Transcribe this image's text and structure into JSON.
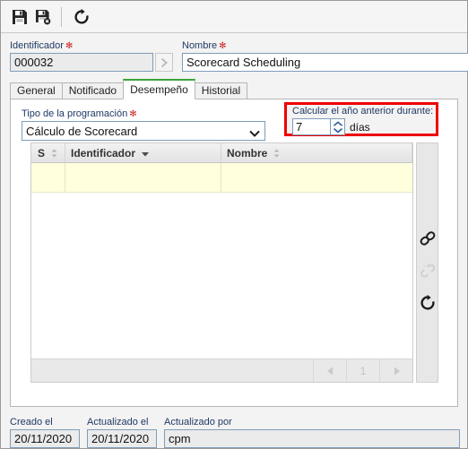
{
  "window": {
    "title": "Scorecard Scheduling"
  },
  "toolbar": {
    "save": {
      "name": "save-icon",
      "title": "Guardar"
    },
    "save_close": {
      "name": "save-and-close-icon",
      "title": "Guardar y cerrar"
    },
    "refresh": {
      "name": "refresh-icon",
      "title": "Actualizar"
    }
  },
  "header": {
    "identifier": {
      "label": "Identificador",
      "required_marker": "✻",
      "value": "000032",
      "nav_button": "›"
    },
    "name": {
      "label": "Nombre",
      "required_marker": "✻",
      "value": "Scorecard Scheduling"
    }
  },
  "tabs": [
    {
      "label": "General",
      "active": false
    },
    {
      "label": "Notificado",
      "active": false
    },
    {
      "label": "Desempeño",
      "active": true
    },
    {
      "label": "Historial",
      "active": false
    }
  ],
  "panel": {
    "schedule_type": {
      "label": "Tipo de la programación",
      "required_marker": "✻",
      "selected": "Cálculo de Scorecard",
      "options": [
        "Cálculo de Scorecard"
      ]
    },
    "previous_year": {
      "label": "Calcular el año anterior durante:",
      "value": "7",
      "unit": "días",
      "highlight_color": "#ee0000"
    },
    "grid": {
      "columns": [
        {
          "label": "S",
          "sort": "⇅"
        },
        {
          "label": "Identificador",
          "sort": "▾"
        },
        {
          "label": "Nombre",
          "sort": "⇅"
        }
      ],
      "rows": [
        {
          "s": "",
          "identificador": "",
          "nombre": ""
        }
      ],
      "pagination": {
        "prev": "◀",
        "page": "1",
        "next": "▶"
      },
      "side_tools": [
        {
          "name": "link-icon",
          "label": "Vincular",
          "enabled": true
        },
        {
          "name": "unlink-icon",
          "label": "Desvincular",
          "enabled": false
        },
        {
          "name": "refresh-icon",
          "label": "Actualizar",
          "enabled": true
        }
      ]
    }
  },
  "footer": {
    "created": {
      "label": "Creado el",
      "value": "20/11/2020"
    },
    "updated": {
      "label": "Actualizado el",
      "value": "20/11/2020"
    },
    "updated_by": {
      "label": "Actualizado por",
      "value": "cpm"
    }
  }
}
